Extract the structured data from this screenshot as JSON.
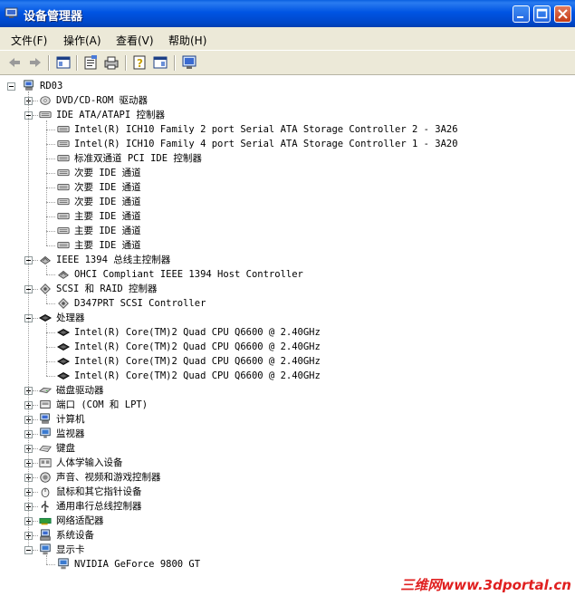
{
  "window": {
    "title": "设备管理器"
  },
  "menu": [
    "文件(F)",
    "操作(A)",
    "查看(V)",
    "帮助(H)"
  ],
  "toolbar": [
    "back-icon",
    "forward-icon",
    "show-hide-tree-icon",
    "properties-icon",
    "print-icon",
    "help-icon",
    "show-hide-console-icon",
    "scan-hardware-icon"
  ],
  "tree": {
    "root": "RD03",
    "categories": [
      {
        "label": "DVD/CD-ROM 驱动器",
        "expanded": false,
        "icon": "cdrom-icon",
        "children": []
      },
      {
        "label": "IDE ATA/ATAPI 控制器",
        "expanded": true,
        "icon": "ide-controller-icon",
        "children": [
          "Intel(R) ICH10 Family 2 port Serial ATA Storage Controller 2 - 3A26",
          "Intel(R) ICH10 Family 4 port Serial ATA Storage Controller 1 - 3A20",
          "标准双通道 PCI IDE 控制器",
          "次要 IDE 通道",
          "次要 IDE 通道",
          "次要 IDE 通道",
          "主要 IDE 通道",
          "主要 IDE 通道",
          "主要 IDE 通道"
        ]
      },
      {
        "label": "IEEE 1394 总线主控制器",
        "expanded": true,
        "icon": "ieee1394-icon",
        "children": [
          "OHCI Compliant IEEE 1394 Host Controller"
        ]
      },
      {
        "label": "SCSI 和 RAID 控制器",
        "expanded": true,
        "icon": "scsi-icon",
        "children": [
          "D347PRT SCSI Controller"
        ]
      },
      {
        "label": "处理器",
        "expanded": true,
        "icon": "processor-icon",
        "children": [
          "Intel(R) Core(TM)2 Quad CPU    Q6600  @ 2.40GHz",
          "Intel(R) Core(TM)2 Quad CPU    Q6600  @ 2.40GHz",
          "Intel(R) Core(TM)2 Quad CPU    Q6600  @ 2.40GHz",
          "Intel(R) Core(TM)2 Quad CPU    Q6600  @ 2.40GHz"
        ]
      },
      {
        "label": "磁盘驱动器",
        "expanded": false,
        "icon": "disk-icon",
        "children": []
      },
      {
        "label": "端口 (COM 和 LPT)",
        "expanded": false,
        "icon": "port-icon",
        "children": []
      },
      {
        "label": "计算机",
        "expanded": false,
        "icon": "computer-icon",
        "children": []
      },
      {
        "label": "监视器",
        "expanded": false,
        "icon": "monitor-icon",
        "children": []
      },
      {
        "label": "键盘",
        "expanded": false,
        "icon": "keyboard-icon",
        "children": []
      },
      {
        "label": "人体学输入设备",
        "expanded": false,
        "icon": "hid-icon",
        "children": []
      },
      {
        "label": "声音、视频和游戏控制器",
        "expanded": false,
        "icon": "sound-icon",
        "children": []
      },
      {
        "label": "鼠标和其它指针设备",
        "expanded": false,
        "icon": "mouse-icon",
        "children": []
      },
      {
        "label": "通用串行总线控制器",
        "expanded": false,
        "icon": "usb-icon",
        "children": []
      },
      {
        "label": "网络适配器",
        "expanded": false,
        "icon": "network-icon",
        "children": []
      },
      {
        "label": "系统设备",
        "expanded": false,
        "icon": "system-icon",
        "children": []
      },
      {
        "label": "显示卡",
        "expanded": true,
        "icon": "display-icon",
        "children": [
          "NVIDIA GeForce 9800 GT"
        ]
      }
    ]
  },
  "watermark": "三维网www.3dportal.cn",
  "colors": {
    "titlebar": "#0054e3",
    "menubar": "#ece9d8",
    "watermark": "#e02020"
  }
}
